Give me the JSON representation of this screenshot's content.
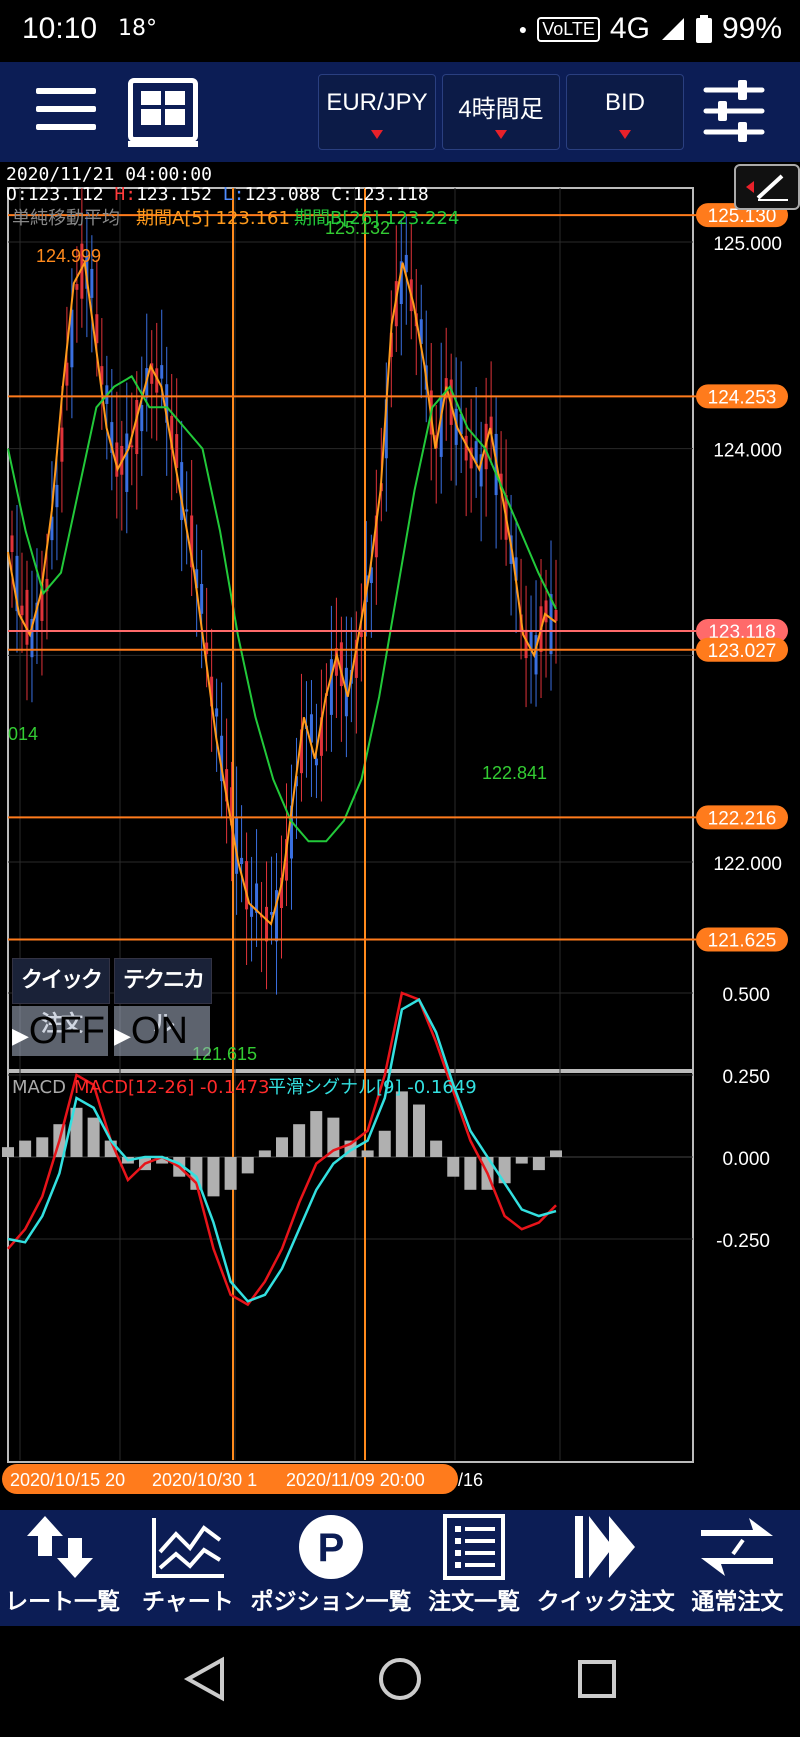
{
  "status_bar": {
    "time": "10:10",
    "temperature": "18°",
    "volte": "VoLTE",
    "network": "4G",
    "battery": "99%"
  },
  "toolbar": {
    "currency_pair": "EUR/JPY",
    "timeframe": "4時間足",
    "price_type": "BID"
  },
  "ohlc": {
    "datetime": "2020/11/21 04:00:00",
    "open_label": "O:",
    "open": "123.112",
    "high_label": "H:",
    "high": "123.152",
    "low_label": "L:",
    "low": "123.088",
    "close_label": "C:",
    "close": "123.118"
  },
  "indicator_legend": {
    "sma_name": "単純移動平均",
    "sma_a": "期間A[5] 123.161",
    "sma_b": "期間B[26] 123.224"
  },
  "macd_legend": {
    "name": "MACD",
    "macd": "MACD[12-26] -0.1473",
    "signal": "平滑シグナル[9] -0.1649"
  },
  "toggles": {
    "quick_order_label": "クイック注文",
    "quick_order_state": "OFF",
    "technical_label": "テクニカル",
    "technical_state": "ON"
  },
  "chart_data": [
    {
      "type": "line",
      "title": "単純移動平均",
      "ylim": [
        121.45,
        125.25
      ],
      "price_ticks": [
        "125.000",
        "124.000",
        "122.000"
      ],
      "horizontal_lines": [
        {
          "label": "125.130",
          "value": 125.13,
          "color": "#ff7b1c"
        },
        {
          "label": "124.253",
          "value": 124.253,
          "color": "#ff7b1c"
        },
        {
          "label": "123.118",
          "value": 123.118,
          "color": "#ff6a6a"
        },
        {
          "label": "123.027",
          "value": 123.027,
          "color": "#ff7b1c"
        },
        {
          "label": "122.216",
          "value": 122.216,
          "color": "#ff7b1c"
        },
        {
          "label": "121.625",
          "value": 121.625,
          "color": "#ff7b1c"
        }
      ],
      "annotations": [
        {
          "text": "124.999",
          "value": 124.999
        },
        {
          "text": "125.132",
          "value": 125.132
        },
        {
          "text": "014",
          "value": 123.014
        },
        {
          "text": "122.841",
          "value": 122.841
        },
        {
          "text": "121.615",
          "value": 121.615
        }
      ],
      "x_labels": [
        "2020/10/15 20",
        "2020/10/30 1",
        "2020/11/09 20:00",
        "/16"
      ],
      "series": [
        {
          "name": "期間A[5]",
          "color": "#ff9a1c",
          "values": [
            123.5,
            123.2,
            123.1,
            123.3,
            123.7,
            124.3,
            124.8,
            124.9,
            124.5,
            124.1,
            123.9,
            124.0,
            124.2,
            124.4,
            124.3,
            124.0,
            123.7,
            123.4,
            123.0,
            122.6,
            122.3,
            122.0,
            121.8,
            121.75,
            121.7,
            121.9,
            122.3,
            122.7,
            122.5,
            122.8,
            123.0,
            122.8,
            123.1,
            123.4,
            123.8,
            124.6,
            124.9,
            124.7,
            124.4,
            124.0,
            124.3,
            124.1,
            124.0,
            123.9,
            124.1,
            123.8,
            123.5,
            123.1,
            123.0,
            123.2,
            123.16
          ]
        },
        {
          "name": "期間B[26]",
          "color": "#22c93a",
          "values": [
            124.0,
            123.6,
            123.3,
            123.4,
            123.8,
            124.2,
            124.3,
            124.35,
            124.2,
            124.2,
            124.1,
            124.0,
            123.6,
            123.1,
            122.7,
            122.4,
            122.2,
            122.1,
            122.1,
            122.2,
            122.4,
            122.8,
            123.3,
            123.8,
            124.2,
            124.3,
            124.1,
            124.0,
            123.8,
            123.6,
            123.4,
            123.224
          ]
        }
      ]
    },
    {
      "type": "line",
      "title": "MACD",
      "ylim": [
        -0.5,
        0.55
      ],
      "ticks": [
        "0.500",
        "0.250",
        "0.000",
        "-0.250"
      ],
      "series": [
        {
          "name": "MACD[12-26]",
          "color": "#e8141a",
          "values": [
            -0.28,
            -0.22,
            -0.12,
            0.05,
            0.25,
            0.22,
            0.05,
            -0.07,
            -0.02,
            0.0,
            -0.03,
            -0.08,
            -0.28,
            -0.42,
            -0.45,
            -0.38,
            -0.28,
            -0.14,
            -0.02,
            0.02,
            0.04,
            0.08,
            0.25,
            0.5,
            0.48,
            0.35,
            0.2,
            0.05,
            -0.05,
            -0.18,
            -0.22,
            -0.2,
            -0.1473
          ]
        },
        {
          "name": "平滑シグナル[9]",
          "color": "#33e0e0",
          "values": [
            -0.25,
            -0.26,
            -0.18,
            -0.05,
            0.18,
            0.15,
            0.05,
            -0.01,
            0.0,
            0.0,
            -0.02,
            -0.06,
            -0.2,
            -0.38,
            -0.44,
            -0.42,
            -0.34,
            -0.22,
            -0.1,
            -0.02,
            0.02,
            0.05,
            0.18,
            0.45,
            0.48,
            0.38,
            0.22,
            0.08,
            0.0,
            -0.08,
            -0.16,
            -0.18,
            -0.1649
          ]
        },
        {
          "name": "histogram",
          "color": "#b0b0b0",
          "values": [
            0.03,
            0.05,
            0.06,
            0.1,
            0.15,
            0.12,
            0.05,
            -0.02,
            -0.04,
            -0.02,
            -0.06,
            -0.1,
            -0.12,
            -0.1,
            -0.05,
            0.02,
            0.06,
            0.1,
            0.14,
            0.12,
            0.05,
            0.02,
            0.08,
            0.2,
            0.16,
            0.05,
            -0.06,
            -0.1,
            -0.1,
            -0.08,
            -0.02,
            -0.04,
            0.02
          ]
        }
      ]
    }
  ],
  "bottom_nav": {
    "rates": "レート一覧",
    "chart": "チャート",
    "positions": "ポジション一覧",
    "orders": "注文一覧",
    "quick_order": "クイック注文",
    "normal_order": "通常注文"
  }
}
